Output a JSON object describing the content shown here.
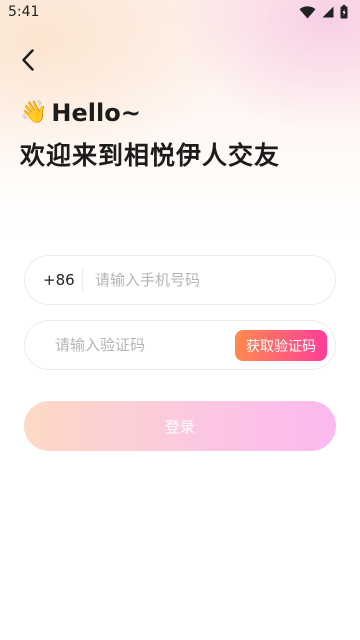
{
  "status_bar": {
    "time": "5:41",
    "icons": [
      "wifi-icon",
      "cellular-signal-icon",
      "battery-icon"
    ]
  },
  "header": {
    "back_icon": "chevron-left-icon",
    "wave_emoji": "👋",
    "greeting": "Hello~",
    "title": "欢迎来到相悦伊人交友"
  },
  "phone_input": {
    "country_code": "+86",
    "placeholder": "请输入手机号码",
    "value": ""
  },
  "code_input": {
    "placeholder": "请输入验证码",
    "value": "",
    "get_code_label": "获取验证码"
  },
  "login": {
    "label": "登录"
  },
  "colors": {
    "accent_start": "#ff8a4e",
    "accent_end": "#ff3e9a",
    "login_start": "#fdd9c4",
    "login_end": "#fbb9ee",
    "text_primary": "#1c1c1c",
    "placeholder": "#b4b4b4"
  }
}
